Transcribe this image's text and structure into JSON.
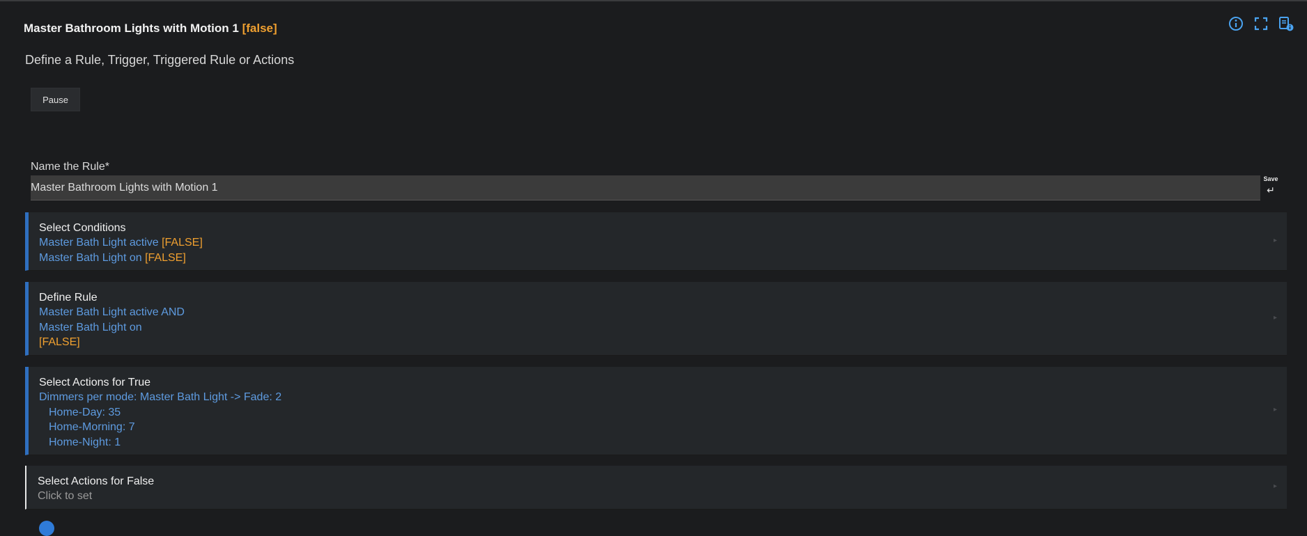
{
  "header": {
    "title": "Master Bathroom Lights with Motion 1",
    "state": "[false]",
    "icons": [
      "info-icon",
      "fullscreen-icon",
      "app-info-icon"
    ]
  },
  "subtitle": "Define a Rule, Trigger, Triggered Rule or Actions",
  "pause_label": "Pause",
  "name_field": {
    "label": "Name the Rule*",
    "value": "Master Bathroom Lights with Motion 1"
  },
  "save": {
    "label": "Save",
    "icon": "↵"
  },
  "panels": {
    "conditions": {
      "title": "Select Conditions",
      "lines": [
        {
          "text": "Master Bath Light active ",
          "status": "[FALSE]"
        },
        {
          "text": "Master Bath Light on ",
          "status": "[FALSE]"
        }
      ]
    },
    "rule": {
      "title": "Define Rule",
      "line1": "Master Bath Light active ",
      "operator": "AND",
      "line2": "Master Bath Light on",
      "status": "[FALSE]"
    },
    "actions_true": {
      "title": "Select Actions for True",
      "lines": [
        "Dimmers per mode: Master Bath Light -> Fade: 2",
        "Home-Day: 35",
        "Home-Morning: 7",
        "Home-Night: 1"
      ]
    },
    "actions_false": {
      "title": "Select Actions for False",
      "placeholder": "Click to set"
    }
  },
  "chevron": "▸",
  "colors": {
    "background": "#1b1c1e",
    "panel": "#24272a",
    "accent_blue": "#2f6fc0",
    "link_blue": "#5e9be0",
    "state_orange": "#f0a030"
  }
}
